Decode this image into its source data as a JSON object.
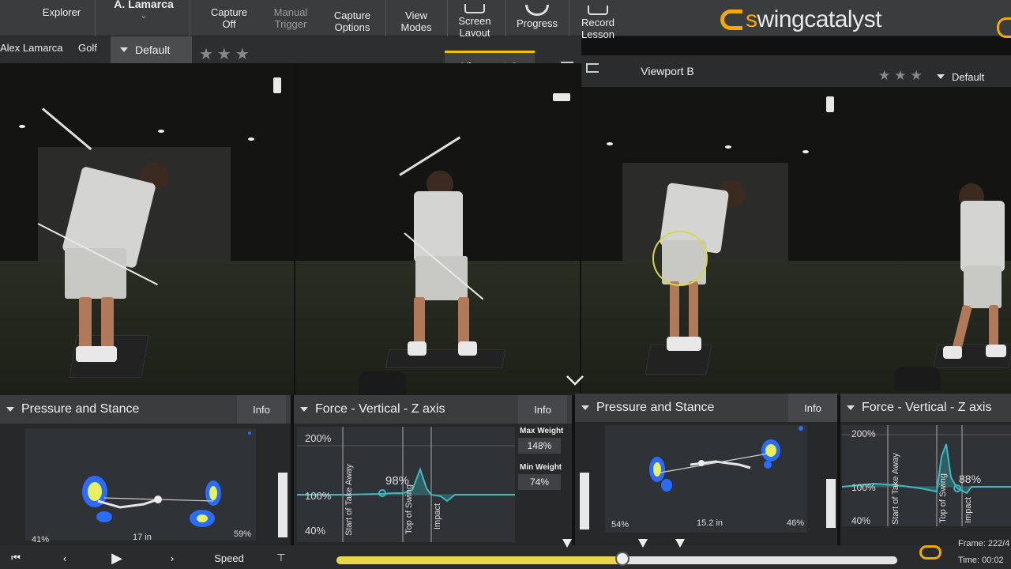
{
  "toolbar": {
    "explorer_label": "Explorer",
    "user_label": "A. Lamarca",
    "capture_off_line1": "Capture",
    "capture_off_line2": "Off",
    "manual_trigger_line1": "Manual",
    "manual_trigger_line2": "Trigger",
    "capture_options_line1": "Capture",
    "capture_options_line2": "Options",
    "view_modes_line1": "View",
    "view_modes_line2": "Modes",
    "screen_layout_line1": "Screen",
    "screen_layout_line2": "Layout",
    "progress_label": "Progress",
    "record_lesson_line1": "Record",
    "record_lesson_line2": "Lesson",
    "logo_prefix": "s",
    "logo_rest": "wingcatalyst"
  },
  "subbar": {
    "player": "Alex Lamarca",
    "sport": "Golf",
    "preset": "Default",
    "stars": "★★★",
    "viewport_a": "Viewport A",
    "viewport_b": "Viewport B",
    "preset_b": "Default"
  },
  "panels": [
    {
      "title": "Pressure and Stance",
      "info_label": "Info",
      "left_pct": "41%",
      "distance": "17 in",
      "right_pct": "59%"
    },
    {
      "title": "Force - Vertical - Z axis",
      "info_label": "Info",
      "y_labels": [
        "200%",
        "100%",
        "40%"
      ],
      "marker_labels": [
        "Start of Take Away",
        "Top of Swing",
        "Impact"
      ],
      "current_value": "98%",
      "max_weight_label": "Max Weight",
      "max_weight_value": "148%",
      "min_weight_label": "Min Weight",
      "min_weight_value": "74%"
    },
    {
      "title": "Pressure and Stance",
      "info_label": "Info",
      "left_pct": "54%",
      "distance": "15.2 in",
      "right_pct": "46%"
    },
    {
      "title": "Force - Vertical - Z axis",
      "y_labels": [
        "200%",
        "100%",
        "40%"
      ],
      "marker_labels": [
        "Start of Take Away",
        "Top of Swing",
        "Impact"
      ],
      "current_value": "88%"
    }
  ],
  "timeline": {
    "speed_label": "Speed",
    "progress_fraction": 0.51,
    "frame_label": "Frame: 222/4",
    "time_label": "Time:   00:02"
  },
  "colors": {
    "accent": "#f2a900",
    "highlight": "#f2c300",
    "force_trace": "#3fb8c0"
  }
}
